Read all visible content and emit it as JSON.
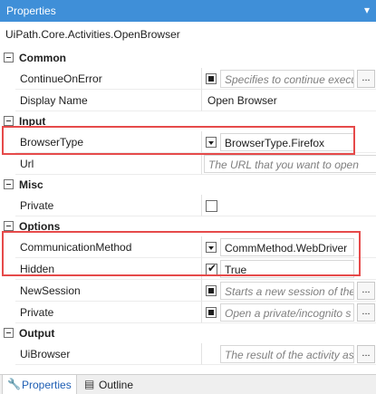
{
  "panel": {
    "title": "Properties",
    "collapse_glyph": "▾",
    "activity_name": "UiPath.Core.Activities.OpenBrowser"
  },
  "categories": {
    "common": {
      "label": "Common"
    },
    "input": {
      "label": "Input"
    },
    "misc": {
      "label": "Misc"
    },
    "options": {
      "label": "Options"
    },
    "output": {
      "label": "Output"
    }
  },
  "properties": {
    "continue_on_error": {
      "label": "ContinueOnError",
      "placeholder": "Specifies to continue execu"
    },
    "display_name": {
      "label": "Display Name",
      "value": "Open Browser"
    },
    "browser_type": {
      "label": "BrowserType",
      "value": "BrowserType.Firefox"
    },
    "url": {
      "label": "Url",
      "placeholder": "The URL that you want to open"
    },
    "misc_private": {
      "label": "Private"
    },
    "communication_method": {
      "label": "CommunicationMethod",
      "value": "CommMethod.WebDriver"
    },
    "hidden": {
      "label": "Hidden",
      "value": "True"
    },
    "new_session": {
      "label": "NewSession",
      "placeholder": "Starts a new session of the"
    },
    "options_private": {
      "label": "Private",
      "placeholder": "Open a private/incognito s"
    },
    "ui_browser": {
      "label": "UiBrowser",
      "placeholder": "The result of the activity as a U"
    }
  },
  "ellipsis_label": "...",
  "tabs": {
    "properties": {
      "label": "Properties"
    },
    "outline": {
      "label": "Outline"
    }
  },
  "icons": {
    "properties_tab": "wrench-icon",
    "outline_tab": "outline-icon"
  },
  "colors": {
    "title_bar": "#3f8fd8",
    "highlight": "#e64a4a",
    "active_tab_text": "#1e5eb4"
  }
}
